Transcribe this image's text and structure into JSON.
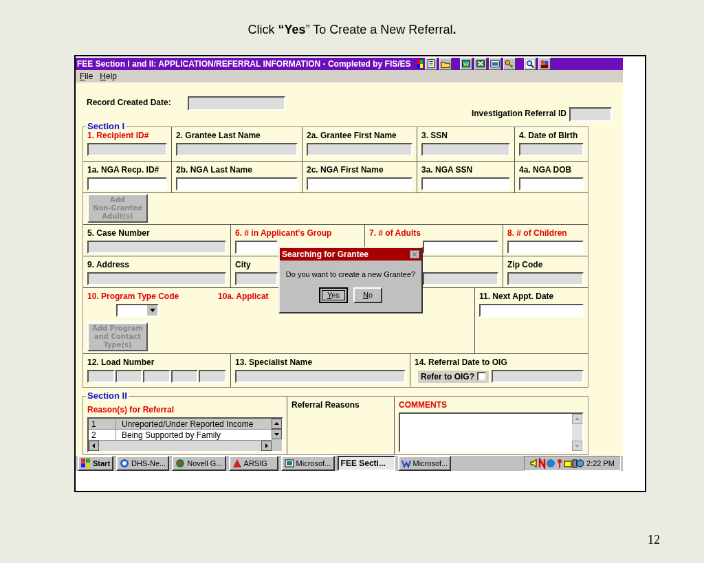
{
  "slide": {
    "title": "Click **“Yes**” To Create a New Referral**.**",
    "page_number": "12"
  },
  "window": {
    "title": "FEE Section I and II:  APPLICATION/REFERRAL INFORMATION - Completed by FIS/ES",
    "menu": [
      "File",
      "Help"
    ]
  },
  "header": {
    "record_created_date": {
      "label": "Record Created Date:"
    },
    "investigation_referral_id": {
      "label": "Investigation Referral ID"
    }
  },
  "section_1": {
    "legend": "Section I",
    "rows": [
      {
        "cells": [
          {
            "label": "1.  Recipient ID#",
            "required": true,
            "field": {
              "kind": "readonly"
            }
          },
          {
            "label": "2.  Grantee Last Name",
            "required": false,
            "field": {
              "kind": "readonly"
            }
          },
          {
            "label": "2a.  Grantee First Name",
            "required": false,
            "field": {
              "kind": "readonly"
            }
          },
          {
            "label": "3.  SSN",
            "required": false,
            "field": {
              "kind": "readonly"
            }
          },
          {
            "label": "4.  Date of Birth",
            "required": false,
            "field": {
              "kind": "readonly"
            }
          }
        ]
      },
      {
        "cells": [
          {
            "label": "1a.  NGA Recp. ID#",
            "required": false,
            "field": {
              "kind": "editable"
            }
          },
          {
            "label": "2b.  NGA Last Name",
            "required": false,
            "field": {
              "kind": "editable"
            }
          },
          {
            "label": "2c.  NGA First Name",
            "required": false,
            "field": {
              "kind": "editable"
            }
          },
          {
            "label": "3a.  NGA SSN",
            "required": false,
            "field": {
              "kind": "editable"
            }
          },
          {
            "label": "4a.  NGA DOB",
            "required": false,
            "field": {
              "kind": "editable"
            }
          }
        ]
      },
      {
        "cells": [
          {
            "button": {
              "label": "Add\nNon-Grantee\nAdult(s)",
              "disabled": true
            }
          }
        ]
      },
      {
        "cells": [
          {
            "label": "5.  Case Number",
            "required": false,
            "field": {
              "kind": "readonly"
            }
          },
          {
            "label": "6.  # in Applicant's Group",
            "required": true,
            "field": {
              "kind": "editable"
            }
          },
          {
            "label": "7.  # of Adults",
            "required": true,
            "field": {
              "kind": "editable"
            }
          },
          {
            "label": "8.  # of Children",
            "required": true,
            "field": {
              "kind": "editable"
            }
          }
        ]
      },
      {
        "cells": [
          {
            "label": "9.  Address",
            "required": false,
            "field": {
              "kind": "readonly"
            }
          },
          {
            "label": "City",
            "required": false,
            "field": {
              "kind": "readonly"
            }
          },
          {
            "field": {
              "kind": "readonly"
            }
          },
          {
            "label": "Zip Code",
            "required": false,
            "field": {
              "kind": "readonly"
            }
          }
        ]
      },
      {
        "cells": [
          {
            "label": "10.  Program Type Code",
            "required": true,
            "field": {
              "kind": "dropdown"
            },
            "button": {
              "label": "Add Program\nand Contact\nType(s)",
              "disabled": true
            }
          },
          {
            "label": "10a.  Applicat",
            "required": true
          },
          {
            "label": "11.  Next Appt. Date",
            "required": false,
            "field": {
              "kind": "editable"
            }
          }
        ]
      },
      {
        "cells": [
          {
            "label": "12.  Load Number",
            "required": false,
            "field": {
              "kind": "segments"
            }
          },
          {
            "label": "13.  Specialist Name",
            "required": false,
            "field": {
              "kind": "readonly"
            }
          },
          {
            "label": "14.  Referral Date to OIG",
            "required": false,
            "field": {
              "kind": "readonly"
            },
            "checkbox": {
              "label": "Refer to OIG?",
              "checked": false
            }
          }
        ]
      }
    ]
  },
  "dialog": {
    "title": "Searching for Grantee",
    "message": "Do you want to create a new Grantee?",
    "buttons": [
      {
        "label": "Yes",
        "focused": true
      },
      {
        "label": "No",
        "focused": false
      }
    ]
  },
  "section_2": {
    "legend": "Section II",
    "reasons_label": "Reason(s)  for Referral",
    "reasons": [
      {
        "number": "1",
        "text": "Unreported/Under Reported Income",
        "selected": true
      },
      {
        "number": "2",
        "text": "Being Supported by Family",
        "selected": false
      }
    ],
    "referral_reasons_label": "Referral Reasons",
    "comments_label": "COMMENTS"
  },
  "taskbar": {
    "start": "Start",
    "items": [
      {
        "label": "DHS-Ne...",
        "active": false
      },
      {
        "label": "Novell G...",
        "active": false
      },
      {
        "label": "ARSIG",
        "active": false
      },
      {
        "label": "Microsof...",
        "active": false
      },
      {
        "label": "FEE Secti...",
        "active": true
      },
      {
        "label": "Microsof...",
        "active": false
      }
    ],
    "time": "2:22 PM"
  }
}
